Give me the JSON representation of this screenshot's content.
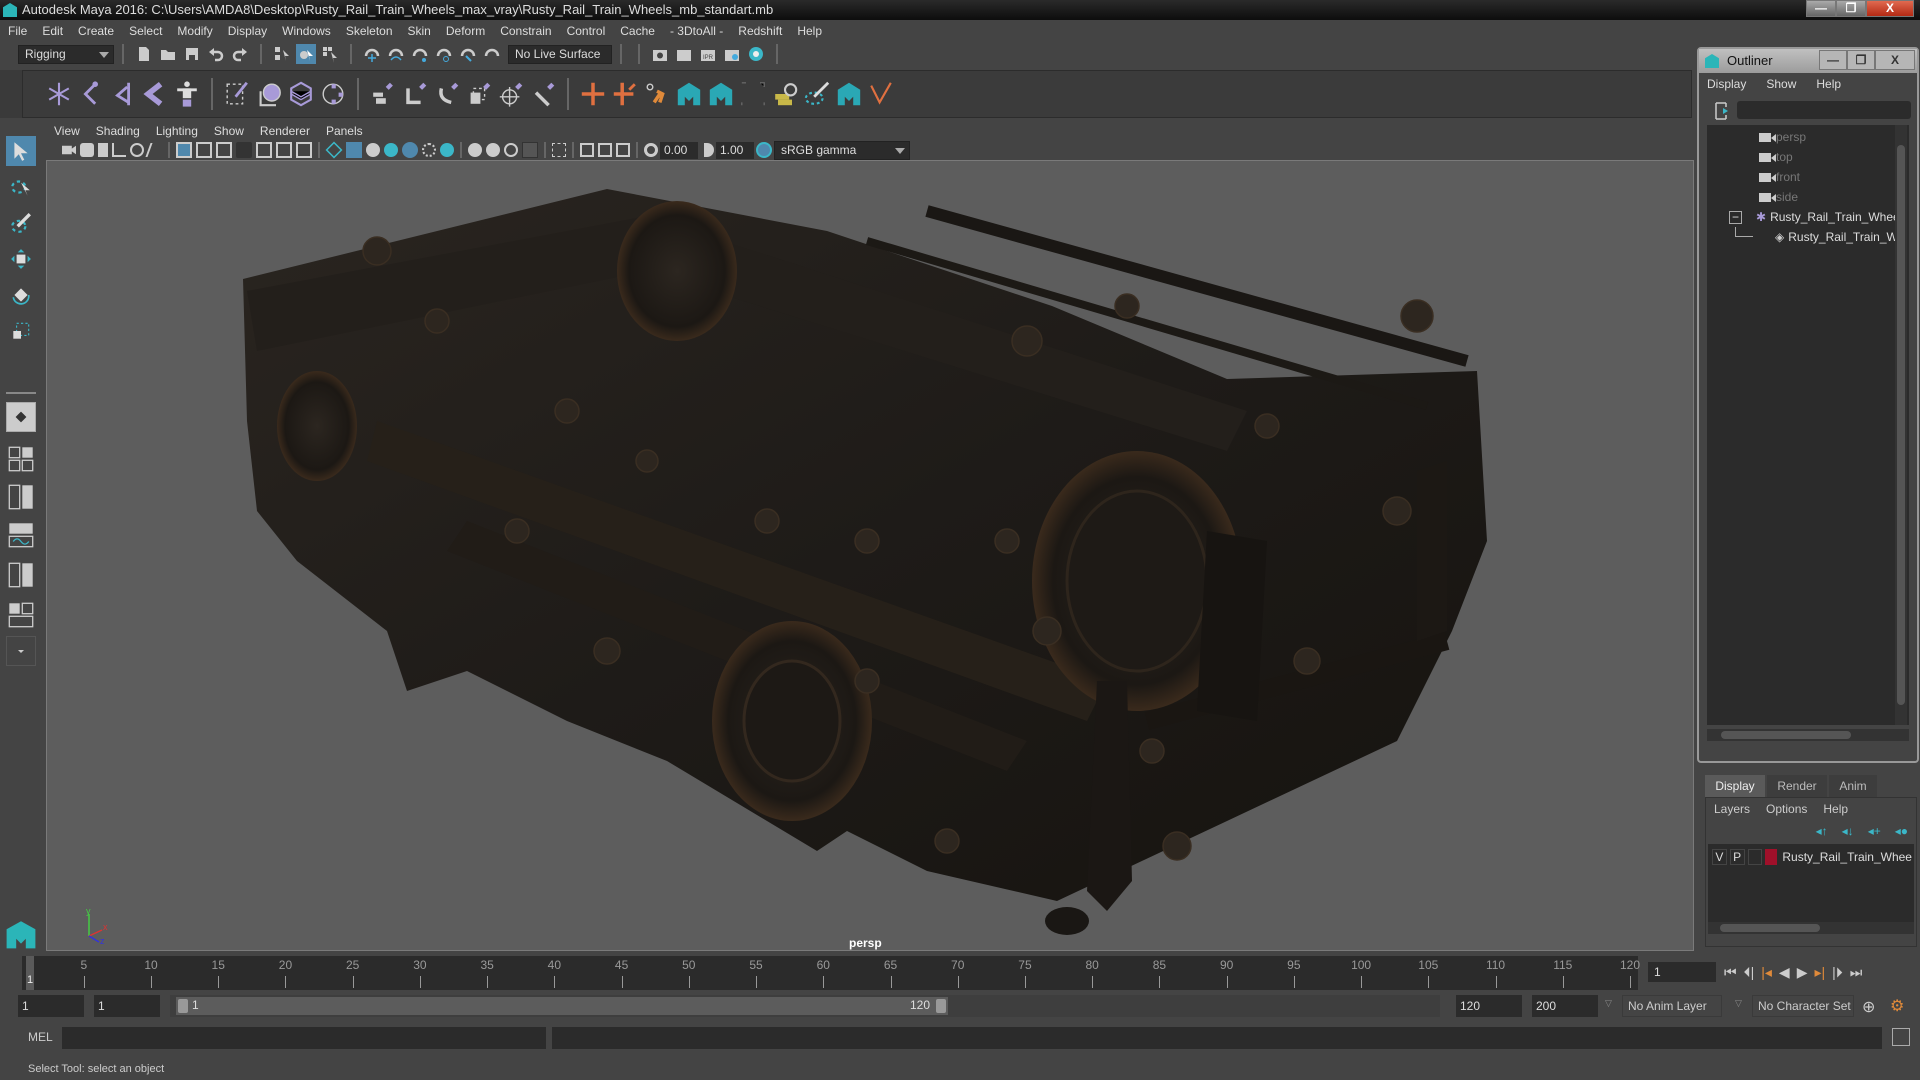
{
  "window": {
    "title": "Autodesk Maya 2016: C:\\Users\\AMDA8\\Desktop\\Rusty_Rail_Train_Wheels_max_vray\\Rusty_Rail_Train_Wheels_mb_standart.mb",
    "minimize": "—",
    "maximize": "❐",
    "close": "X"
  },
  "menubar": [
    "File",
    "Edit",
    "Create",
    "Select",
    "Modify",
    "Display",
    "Windows",
    "Skeleton",
    "Skin",
    "Deform",
    "Constrain",
    "Control",
    "Cache",
    "- 3DtoAll -",
    "Redshift",
    "Help"
  ],
  "statusline": {
    "menuset": "Rigging",
    "live_surface": "No Live Surface"
  },
  "viewport": {
    "menu": [
      "View",
      "Shading",
      "Lighting",
      "Show",
      "Renderer",
      "Panels"
    ],
    "exposure": "0.00",
    "gamma": "1.00",
    "color_space": "sRGB gamma",
    "camera_label": "persp",
    "axis": {
      "x": "x",
      "y": "y",
      "z": "z"
    }
  },
  "outliner": {
    "title": "Outliner",
    "menu": [
      "Display",
      "Show",
      "Help"
    ],
    "filter_value": "",
    "items": [
      {
        "label": "persp",
        "type": "camera"
      },
      {
        "label": "top",
        "type": "camera"
      },
      {
        "label": "front",
        "type": "camera"
      },
      {
        "label": "side",
        "type": "camera"
      },
      {
        "label": "Rusty_Rail_Train_Wheels_",
        "type": "group",
        "expanded": true
      },
      {
        "label": "Rusty_Rail_Train_Whe",
        "type": "mesh"
      }
    ]
  },
  "layer_editor": {
    "tabs": [
      "Display",
      "Render",
      "Anim"
    ],
    "active_tab": "Display",
    "menu": [
      "Layers",
      "Options",
      "Help"
    ],
    "layers": [
      {
        "v": "V",
        "p": "P",
        "color": "#a0102a",
        "name": "Rusty_Rail_Train_Whee"
      }
    ]
  },
  "timeline": {
    "ticks": [
      5,
      10,
      15,
      20,
      25,
      30,
      35,
      40,
      45,
      50,
      55,
      60,
      65,
      70,
      75,
      80,
      85,
      90,
      95,
      100,
      105,
      110,
      115,
      120
    ],
    "current_frame_marker": "1",
    "current_frame": "1",
    "range_start": "1",
    "playback_start": "1",
    "slider_start": "1",
    "slider_end": "120",
    "playback_end": "120",
    "range_end": "200",
    "anim_layer": "No Anim Layer",
    "character_set": "No Character Set"
  },
  "command_line": {
    "label": "MEL",
    "value": ""
  },
  "help_line": "Select Tool: select an object"
}
